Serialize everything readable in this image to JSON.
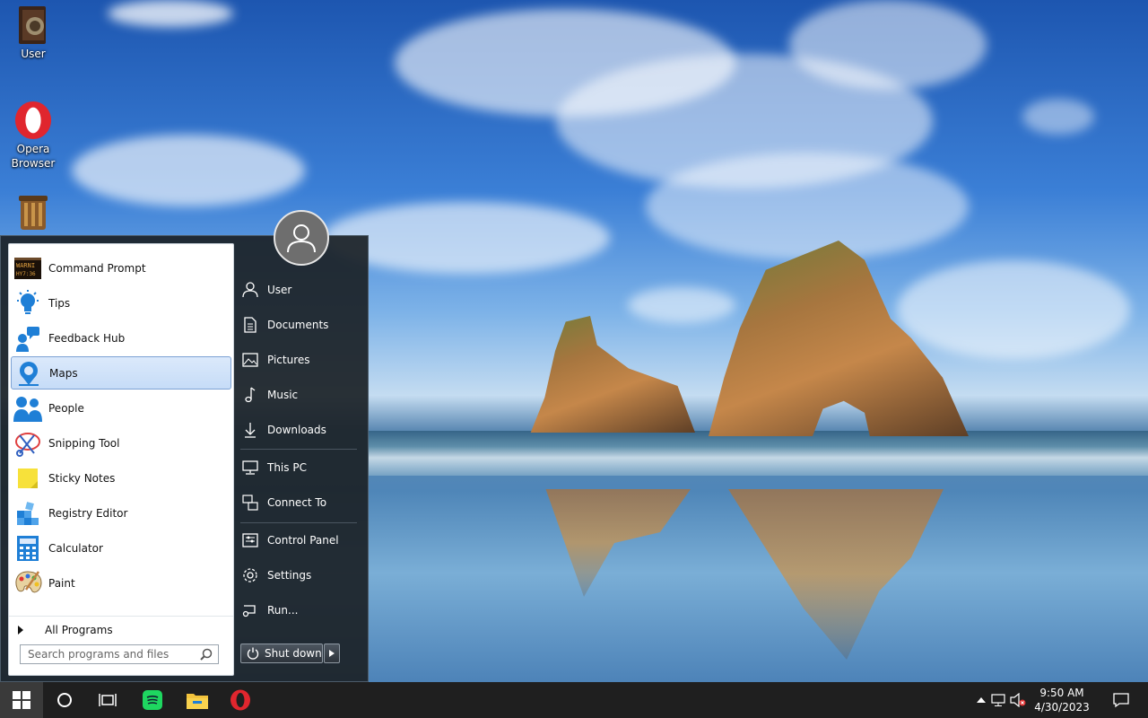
{
  "desktop": {
    "icons": [
      {
        "label": "User",
        "icon": "user-folder-icon"
      },
      {
        "label": "Opera\nBrowser",
        "label_line1": "Opera",
        "label_line2": "Browser",
        "icon": "opera-icon"
      },
      {
        "label": "",
        "icon": "recycle-bin-icon"
      }
    ]
  },
  "start_menu": {
    "programs": [
      {
        "label": "Command Prompt",
        "icon": "command-prompt-icon",
        "badge_text": "WARNI HY 7:36"
      },
      {
        "label": "Tips",
        "icon": "lightbulb-icon"
      },
      {
        "label": "Feedback Hub",
        "icon": "feedback-icon"
      },
      {
        "label": "Maps",
        "icon": "map-pin-icon"
      },
      {
        "label": "People",
        "icon": "people-icon"
      },
      {
        "label": "Snipping Tool",
        "icon": "scissors-icon"
      },
      {
        "label": "Sticky Notes",
        "icon": "sticky-note-icon"
      },
      {
        "label": "Registry Editor",
        "icon": "registry-icon"
      },
      {
        "label": "Calculator",
        "icon": "calculator-icon"
      },
      {
        "label": "Paint",
        "icon": "palette-icon"
      }
    ],
    "all_programs_label": "All Programs",
    "search_placeholder": "Search programs and files",
    "right_items": [
      {
        "label": "User",
        "icon": "user-icon"
      },
      {
        "label": "Documents",
        "icon": "document-icon"
      },
      {
        "label": "Pictures",
        "icon": "picture-icon"
      },
      {
        "label": "Music",
        "icon": "music-note-icon"
      },
      {
        "label": "Downloads",
        "icon": "download-icon"
      },
      {
        "label": "This PC",
        "icon": "monitor-icon"
      },
      {
        "label": "Connect To",
        "icon": "connect-icon"
      },
      {
        "label": "Control Panel",
        "icon": "control-panel-icon"
      },
      {
        "label": "Settings",
        "icon": "gear-icon"
      },
      {
        "label": "Run...",
        "icon": "run-icon"
      }
    ],
    "shutdown_label": "Shut down"
  },
  "taskbar": {
    "time": "9:50 AM",
    "date": "4/30/2023"
  },
  "colors": {
    "start_bg": "#1c2228",
    "hover_bg": "#c6dcf7",
    "taskbar_bg": "#1f1f1f",
    "opera_red": "#e0262e",
    "spotify_green": "#1ed760"
  }
}
